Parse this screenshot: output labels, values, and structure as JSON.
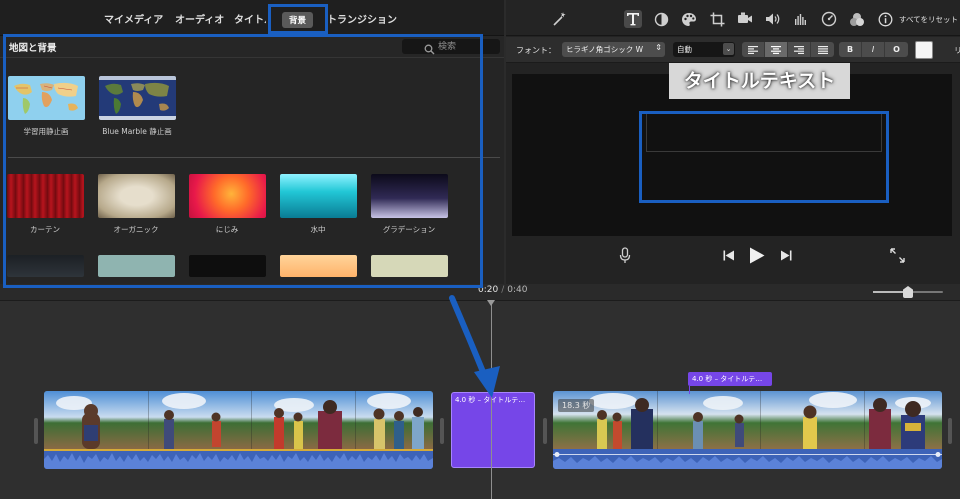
{
  "browser": {
    "tabs": [
      {
        "label": "マイメディア",
        "active": false
      },
      {
        "label": "オーディオ",
        "active": false
      },
      {
        "label": "タイトル",
        "active": false
      },
      {
        "label": "背景",
        "active": true
      },
      {
        "label": "トランジション",
        "active": false
      }
    ],
    "section_title": "地図と背景",
    "search": {
      "placeholder": "検索",
      "icon": "magnifier-icon"
    },
    "maps": [
      {
        "label": "学習用静止画"
      },
      {
        "label": "Blue Marble 静止画"
      }
    ],
    "backgrounds": [
      {
        "label": "カーテン"
      },
      {
        "label": "オーガニック"
      },
      {
        "label": "にじみ"
      },
      {
        "label": "水中"
      },
      {
        "label": "グラデーション"
      }
    ],
    "more_backgrounds_visible": 5
  },
  "viewer": {
    "toolbar_icons": [
      "magic-wand-icon",
      "title-text-icon",
      "color-balance-icon",
      "color-palette-icon",
      "crop-icon",
      "video-camera-icon",
      "volume-icon",
      "equalizer-icon",
      "speedometer-icon",
      "filters-icon",
      "info-icon"
    ],
    "reset_label": "すべてをリセット",
    "font_label": "フォント：",
    "font_name": "ヒラギノ角ゴシック W",
    "size_value": "自動",
    "style_buttons": [
      "B",
      "I",
      "O"
    ],
    "more_label": "リ",
    "title_text": "タイトルテキスト"
  },
  "timeline": {
    "timecode_current": "0:20",
    "timecode_total": "0:40",
    "timecode_separator": "/",
    "zoom_level": 0.5,
    "title_clip_label": "4.0 秒 – タイトルテ…",
    "title_tag_label": "4.0 秒 – タイトルテ…",
    "clip_duration": "18.3 秒"
  },
  "colors": {
    "highlight": "#1a5fc1",
    "title_clip": "#7646e8",
    "audio_wave": "#3d63b8"
  }
}
